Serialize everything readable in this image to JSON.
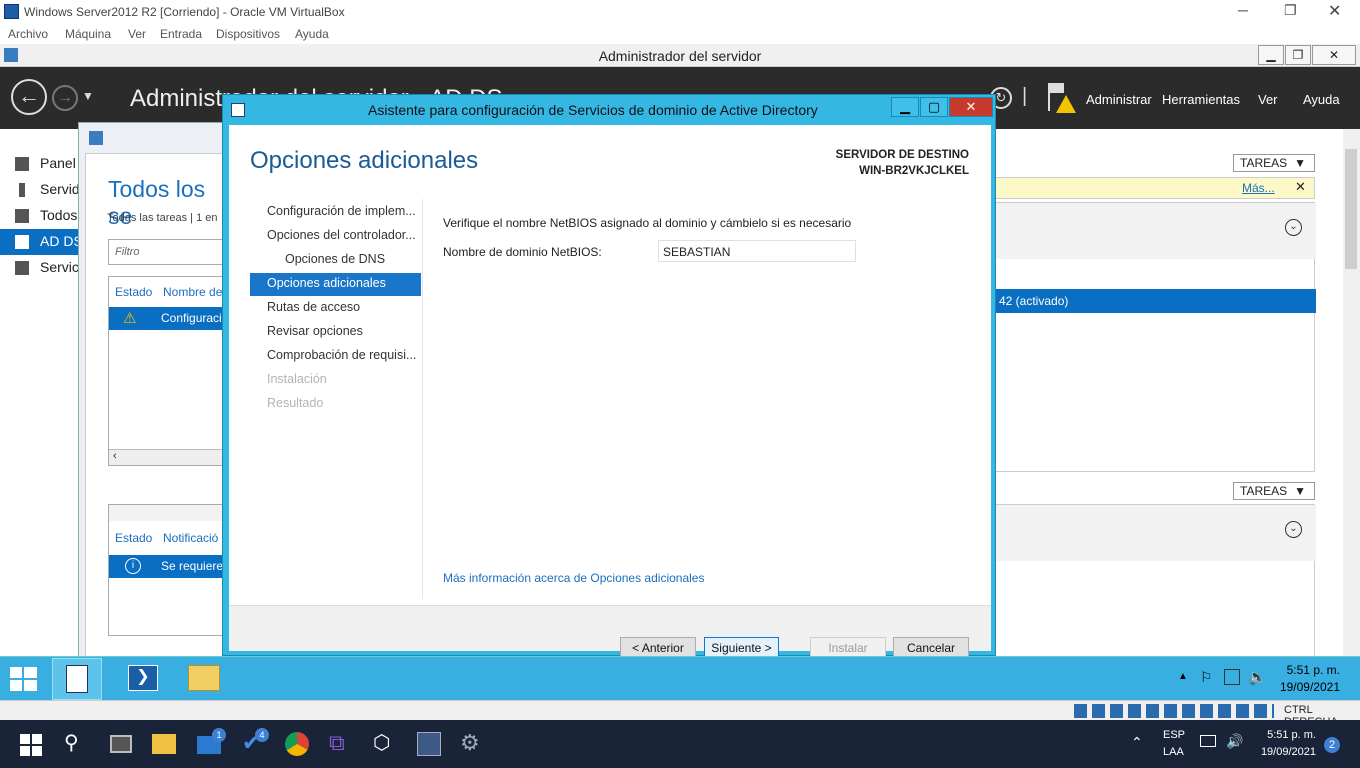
{
  "vbox": {
    "title": "Windows Server2012 R2 [Corriendo] - Oracle VM VirtualBox",
    "menu": [
      "Archivo",
      "Máquina",
      "Ver",
      "Entrada",
      "Dispositivos",
      "Ayuda"
    ],
    "status_right": "CTRL DERECHA"
  },
  "server_manager": {
    "title": "Administrador del servidor",
    "header_title": "Administrador del servidor • AD DS",
    "menu": [
      "Administrar",
      "Herramientas",
      "Ver",
      "Ayuda"
    ],
    "nav": [
      "Panel",
      "Servid",
      "Todos",
      "AD DS",
      "Servici"
    ],
    "page_title": "Todos los se",
    "subtitle": "Todas las tareas | 1 en",
    "filter_placeholder": "Filtro",
    "col_state": "Estado",
    "col_name": "Nombre de",
    "row1": "Configuraci",
    "col_state2": "Estado",
    "col_notif": "Notificació",
    "row2": "Se requiere",
    "tareas": "TAREAS",
    "mas": "Más...",
    "activated": "42 (activado)"
  },
  "wizard": {
    "title": "Asistente para configuración de Servicios de dominio de Active Directory",
    "heading": "Opciones adicionales",
    "dest_label": "SERVIDOR DE DESTINO",
    "dest_server": "WIN-BR2VKJCLKEL",
    "steps": [
      "Configuración de implem...",
      "Opciones del controlador...",
      "Opciones de DNS",
      "Opciones adicionales",
      "Rutas de acceso",
      "Revisar opciones",
      "Comprobación de requisi...",
      "Instalación",
      "Resultado"
    ],
    "instruction": "Verifique el nombre NetBIOS asignado al dominio y cámbielo si es necesario",
    "netbios_label": "Nombre de dominio NetBIOS:",
    "netbios_value": "SEBASTIAN",
    "more_info": "Más información acerca de Opciones adicionales",
    "btn_prev": "< Anterior",
    "btn_next": "Siguiente >",
    "btn_install": "Instalar",
    "btn_cancel": "Cancelar"
  },
  "guest_clock": {
    "time": "5:51 p. m.",
    "date": "19/09/2021"
  },
  "host_tray": {
    "lang1": "ESP",
    "lang2": "LAA",
    "time": "5:51 p. m.",
    "date": "19/09/2021",
    "notif_count": "2",
    "mail_badge": "1",
    "todo_badge": "4"
  }
}
